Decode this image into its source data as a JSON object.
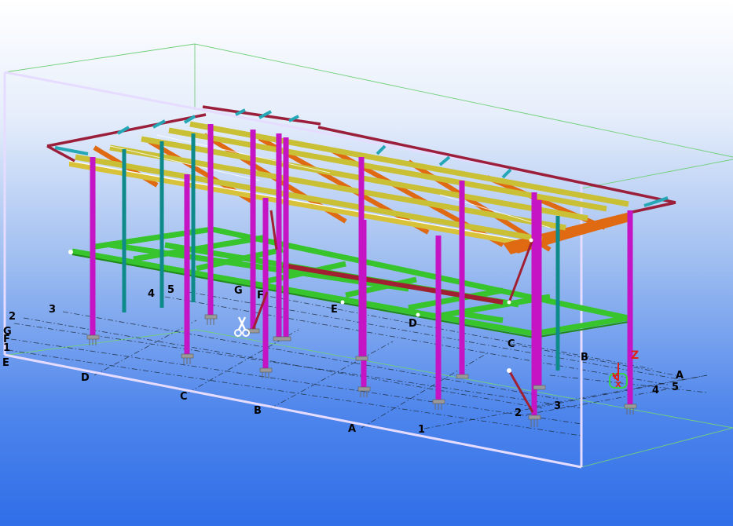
{
  "model_view": {
    "grid_labels": {
      "left_row": [
        "2",
        "3",
        "G",
        "F",
        "1",
        "E"
      ],
      "left_upper": [
        "4",
        "5",
        "G",
        "F",
        "E",
        "D",
        "C"
      ],
      "front": [
        "D",
        "C",
        "B",
        "A",
        "1"
      ],
      "right": [
        "B",
        "2",
        "3",
        "A",
        "4",
        "5"
      ]
    },
    "axes": {
      "z": "Z",
      "y": "Y",
      "x": "X"
    },
    "colors": {
      "column": "#c414c4",
      "column_teal": "#0f8a8a",
      "floor_beam": "#37c42c",
      "floor_beam_dark": "#1f8a1a",
      "roof_purlin": "#c9c035",
      "roof_rafter": "#e06a12",
      "roof_edge": "#9b1f3a",
      "roof_bracing": "#25a7b5",
      "brace": "#a11f33",
      "base_plate": "#9a9a9a",
      "bounding_box": "#e6dcff",
      "work_area": "#72d07a"
    }
  }
}
